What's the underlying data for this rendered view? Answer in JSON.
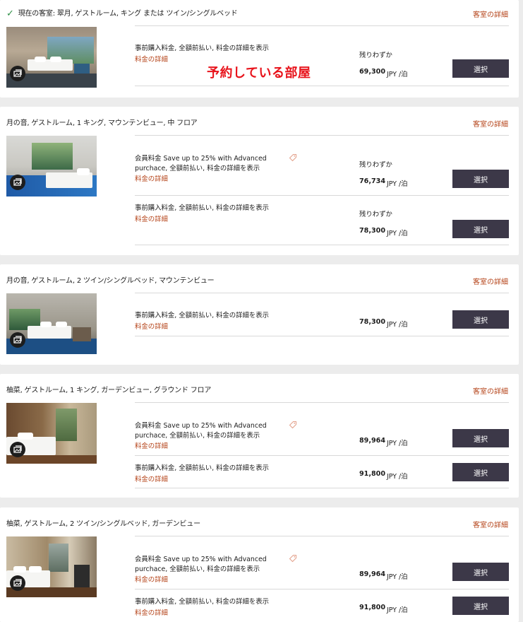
{
  "annotation": "予約している部屋",
  "icons": {
    "current": "checkmark-icon",
    "gallery": "photo-gallery-icon",
    "member_tag": "tag-icon"
  },
  "colors": {
    "accent_link": "#b5441a",
    "button": "#3c3848",
    "check": "#2d8f46",
    "annotation": "#e8131b"
  },
  "rooms": [
    {
      "title_prefix": "現在の客室: ",
      "title": "翠月, ゲストルーム, キング または ツイン/シングルベッド",
      "details_label": "客室の詳細",
      "rates": [
        {
          "name_line1": "事前購入料金, 全額前払い, 料金の詳細を表示",
          "name_line2": "",
          "link": "料金の詳細",
          "availability": "残りわずか",
          "price": "69,300",
          "unit": "JPY /泊",
          "button": "選択"
        }
      ]
    },
    {
      "title": "月の音, ゲストルーム, 1 キング, マウンテンビュー, 中 フロア",
      "details_label": "客室の詳細",
      "rates": [
        {
          "name_line1": "会員料金 Save up to 25% with Advanced",
          "name_line2": "purchace, 全額前払い, 料金の詳細を表示",
          "link": "料金の詳細",
          "availability": "残りわずか",
          "price": "76,734",
          "unit": "JPY /泊",
          "button": "選択"
        },
        {
          "name_line1": "事前購入料金, 全額前払い, 料金の詳細を表示",
          "name_line2": "",
          "link": "料金の詳細",
          "availability": "残りわずか",
          "price": "78,300",
          "unit": "JPY /泊",
          "button": "選択"
        }
      ]
    },
    {
      "title": "月の音, ゲストルーム, 2 ツイン/シングルベッド, マウンテンビュー",
      "details_label": "客室の詳細",
      "rates": [
        {
          "name_line1": "事前購入料金, 全額前払い, 料金の詳細を表示",
          "name_line2": "",
          "link": "料金の詳細",
          "availability": "",
          "price": "78,300",
          "unit": "JPY /泊",
          "button": "選択"
        }
      ]
    },
    {
      "title": "柚菜, ゲストルーム, 1 キング, ガーデンビュー, グラウンド フロア",
      "details_label": "客室の詳細",
      "rates": [
        {
          "name_line1": "会員料金 Save up to 25% with Advanced",
          "name_line2": "purchace, 全額前払い, 料金の詳細を表示",
          "link": "料金の詳細",
          "availability": "",
          "price": "89,964",
          "unit": "JPY /泊",
          "button": "選択"
        },
        {
          "name_line1": "事前購入料金, 全額前払い, 料金の詳細を表示",
          "name_line2": "",
          "link": "料金の詳細",
          "availability": "",
          "price": "91,800",
          "unit": "JPY /泊",
          "button": "選択"
        }
      ]
    },
    {
      "title": "柚菜, ゲストルーム, 2 ツイン/シングルベッド, ガーデンビュー",
      "details_label": "客室の詳細",
      "rates": [
        {
          "name_line1": "会員料金 Save up to 25% with Advanced",
          "name_line2": "purchace, 全額前払い, 料金の詳細を表示",
          "link": "料金の詳細",
          "availability": "",
          "price": "89,964",
          "unit": "JPY /泊",
          "button": "選択"
        },
        {
          "name_line1": "事前購入料金, 全額前払い, 料金の詳細を表示",
          "name_line2": "",
          "link": "料金の詳細",
          "availability": "",
          "price": "91,800",
          "unit": "JPY /泊",
          "button": "選択"
        }
      ]
    }
  ]
}
